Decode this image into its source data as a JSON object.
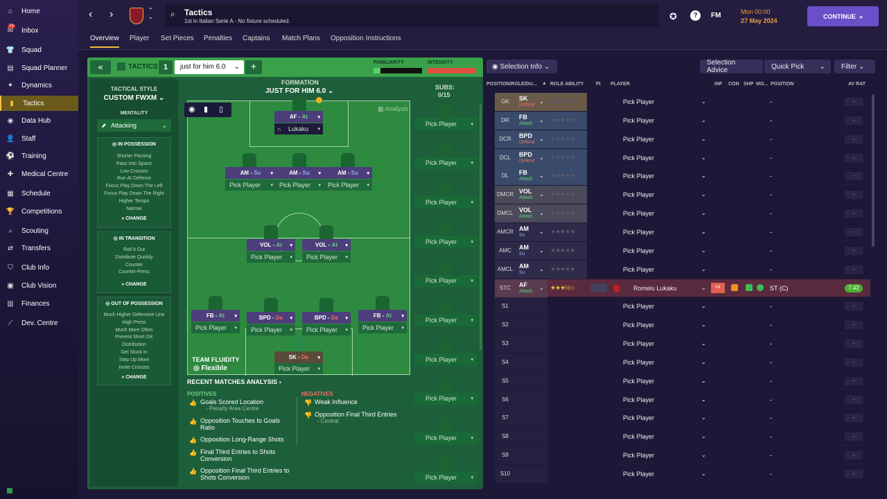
{
  "sidebar": {
    "items": [
      {
        "label": "Home",
        "icon": "home-icon"
      },
      {
        "label": "Inbox",
        "icon": "inbox-icon",
        "badge": "79"
      },
      {
        "label": "Squad",
        "icon": "squad-icon"
      },
      {
        "label": "Squad Planner",
        "icon": "clipboard-icon"
      },
      {
        "label": "Dynamics",
        "icon": "dynamics-icon"
      },
      {
        "label": "Tactics",
        "icon": "tactics-icon"
      },
      {
        "label": "Data Hub",
        "icon": "datahub-icon"
      },
      {
        "label": "Staff",
        "icon": "staff-icon"
      },
      {
        "label": "Training",
        "icon": "training-icon"
      },
      {
        "label": "Medical Centre",
        "icon": "medical-icon"
      },
      {
        "label": "Schedule",
        "icon": "calendar-icon"
      },
      {
        "label": "Competitions",
        "icon": "trophy-icon"
      },
      {
        "label": "Scouting",
        "icon": "scouting-icon"
      },
      {
        "label": "Transfers",
        "icon": "transfers-icon"
      },
      {
        "label": "Club Info",
        "icon": "shield-icon"
      },
      {
        "label": "Club Vision",
        "icon": "vision-icon"
      },
      {
        "label": "Finances",
        "icon": "finances-icon"
      },
      {
        "label": "Dev. Centre",
        "icon": "devcentre-icon"
      }
    ]
  },
  "header": {
    "title": "Tactics",
    "subtitle": "1st in Italian Serie A - No fixture scheduled.",
    "date_time": "Mon 00:00",
    "date": "27 May 2024",
    "fm": "FM",
    "continue": "CONTINUE"
  },
  "tabs": [
    "Overview",
    "Player",
    "Set Pieces",
    "Penalties",
    "Captains",
    "Match Plans",
    "Opposition Instructions"
  ],
  "tactic": {
    "label": "TACTICS",
    "slot": "1",
    "name": "just for him 6.0",
    "familiarity": "FAMILIARITY",
    "intensity": "INTENSITY",
    "style_label": "TACTICAL STYLE",
    "style": "CUSTOM FWXM",
    "mentality_label": "MENTALITY",
    "mentality": "Attacking",
    "formation_label": "FORMATION",
    "formation": "JUST FOR HIM 6.0",
    "subs_label": "SUBS:",
    "subs_count": "0/15",
    "analysis": "Analysis",
    "fluidity_label": "TEAM FLUIDITY",
    "fluidity": "Flexible",
    "change": "CHANGE"
  },
  "in_possession": {
    "title": "IN POSSESSION",
    "items": [
      "Shorter Passing",
      "Pass Into Space",
      "Low Crosses",
      "Run At Defence",
      "Focus Play Down The Left",
      "Focus Play Down The Right",
      "Higher Tempo",
      "Narrow"
    ]
  },
  "in_transition": {
    "title": "IN TRANSITION",
    "items": [
      "Roll It Out",
      "Distribute Quickly",
      "Counter",
      "Counter-Press"
    ]
  },
  "out_of_possession": {
    "title": "OUT OF POSSESSION",
    "items": [
      "Much Higher Defensive Line",
      "High Press",
      "Much More Often",
      "Prevent Short GK",
      "Distribution",
      "Get Stuck In",
      "Step Up More",
      "Invite Crosses"
    ]
  },
  "pitch_positions": [
    {
      "role": "AF",
      "duty": "At",
      "player": "Lukaku"
    },
    {
      "role": "AM",
      "duty": "Su",
      "player": "Pick Player"
    },
    {
      "role": "AM",
      "duty": "Su",
      "player": "Pick Player"
    },
    {
      "role": "AM",
      "duty": "Su",
      "player": "Pick Player"
    },
    {
      "role": "VOL",
      "duty": "At",
      "player": "Pick Player"
    },
    {
      "role": "VOL",
      "duty": "At",
      "player": "Pick Player"
    },
    {
      "role": "FB",
      "duty": "At",
      "player": "Pick Player"
    },
    {
      "role": "BPD",
      "duty": "De",
      "player": "Pick Player"
    },
    {
      "role": "BPD",
      "duty": "De",
      "player": "Pick Player"
    },
    {
      "role": "FB",
      "duty": "At",
      "player": "Pick Player"
    },
    {
      "role": "SK",
      "duty": "De",
      "player": "Pick Player"
    }
  ],
  "pick_player": "Pick Player",
  "analysis_section": {
    "title": "RECENT MATCHES ANALYSIS",
    "positives_label": "POSITIVES",
    "positives": [
      {
        "text": "Goals Scored Location",
        "sub": "- Penalty Area Centre"
      },
      {
        "text": "Opposition Touches to Goals Ratio",
        "sub": ""
      },
      {
        "text": "Opposition Long-Range Shots",
        "sub": ""
      },
      {
        "text": "Final Third Entries to Shots Conversion",
        "sub": ""
      },
      {
        "text": "Opposition Final Third Entries to Shots Conversion",
        "sub": ""
      }
    ],
    "negatives_label": "NEGATIVES",
    "negatives": [
      {
        "text": "Weak Influence",
        "sub": ""
      },
      {
        "text": "Opposition Final Third Entries",
        "sub": "- Central"
      }
    ]
  },
  "right_panel": {
    "selection_info": "Selection Info",
    "selection_advice": "Selection Advice",
    "quick_pick": "Quick Pick",
    "filter": "Filter",
    "headers": [
      "POSITION/ROLE/DU...",
      "ROLE ABILITY",
      "PI",
      "PLAYER",
      "INF",
      "CON",
      "SHP",
      "MO...",
      "POSITION",
      "AV RAT"
    ],
    "rows": [
      {
        "pos": "GK",
        "role": "SK",
        "duty": "Defend",
        "player": "Pick Player",
        "position": "-",
        "rating": "-"
      },
      {
        "pos": "DR",
        "role": "FB",
        "duty": "Attack",
        "player": "Pick Player",
        "position": "-",
        "rating": "-"
      },
      {
        "pos": "DCR",
        "role": "BPD",
        "duty": "Defend",
        "player": "Pick Player",
        "position": "-",
        "rating": "-"
      },
      {
        "pos": "DCL",
        "role": "BPD",
        "duty": "Defend",
        "player": "Pick Player",
        "position": "-",
        "rating": "-"
      },
      {
        "pos": "DL",
        "role": "FB",
        "duty": "Attack",
        "player": "Pick Player",
        "position": "-",
        "rating": "-"
      },
      {
        "pos": "DMCR",
        "role": "VOL",
        "duty": "Attack",
        "player": "Pick Player",
        "position": "-",
        "rating": "-"
      },
      {
        "pos": "DMCL",
        "role": "VOL",
        "duty": "Attack",
        "player": "Pick Player",
        "position": "-",
        "rating": "-"
      },
      {
        "pos": "AMCR",
        "role": "AM",
        "duty": "Su",
        "player": "Pick Player",
        "position": "-",
        "rating": "-"
      },
      {
        "pos": "AMC",
        "role": "AM",
        "duty": "Su",
        "player": "Pick Player",
        "position": "-",
        "rating": "-"
      },
      {
        "pos": "AMCL",
        "role": "AM",
        "duty": "Su",
        "player": "Pick Player",
        "position": "-",
        "rating": "-"
      },
      {
        "pos": "STC",
        "role": "AF",
        "duty": "Attack",
        "player": "Romelu Lukaku",
        "position": "ST (C)",
        "rating": "7.42",
        "inf": "Int"
      },
      {
        "pos": "S1",
        "role": "",
        "duty": "",
        "player": "Pick Player",
        "position": "-",
        "rating": "-"
      },
      {
        "pos": "S2",
        "role": "",
        "duty": "",
        "player": "Pick Player",
        "position": "-",
        "rating": "-"
      },
      {
        "pos": "S3",
        "role": "",
        "duty": "",
        "player": "Pick Player",
        "position": "-",
        "rating": "-"
      },
      {
        "pos": "S4",
        "role": "",
        "duty": "",
        "player": "Pick Player",
        "position": "-",
        "rating": "-"
      },
      {
        "pos": "S5",
        "role": "",
        "duty": "",
        "player": "Pick Player",
        "position": "-",
        "rating": "-"
      },
      {
        "pos": "S6",
        "role": "",
        "duty": "",
        "player": "Pick Player",
        "position": "-",
        "rating": "-"
      },
      {
        "pos": "S7",
        "role": "",
        "duty": "",
        "player": "Pick Player",
        "position": "-",
        "rating": "-"
      },
      {
        "pos": "S8",
        "role": "",
        "duty": "",
        "player": "Pick Player",
        "position": "-",
        "rating": "-"
      },
      {
        "pos": "S9",
        "role": "",
        "duty": "",
        "player": "Pick Player",
        "position": "-",
        "rating": "-"
      },
      {
        "pos": "S10",
        "role": "",
        "duty": "",
        "player": "Pick Player",
        "position": "-",
        "rating": "-"
      }
    ]
  }
}
